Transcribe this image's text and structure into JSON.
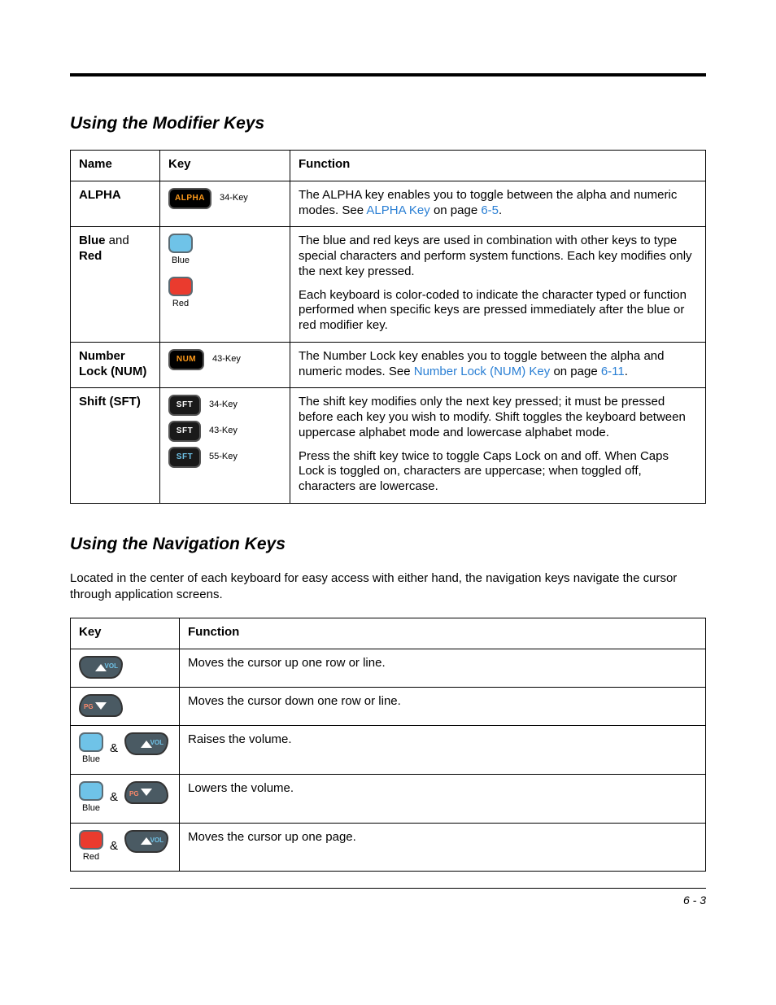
{
  "section1": {
    "title": "Using the Modifier Keys",
    "headers": {
      "name": "Name",
      "key": "Key",
      "function": "Function"
    },
    "rows": {
      "alpha": {
        "name": "ALPHA",
        "keycap": "ALPHA",
        "keycap_note": "34-Key",
        "func_pre": "The ALPHA key enables you to toggle between the alpha and numeric modes. See ",
        "func_link": "ALPHA Key",
        "func_mid": " on page ",
        "func_page": "6-5",
        "func_post": "."
      },
      "bluered": {
        "name_a": "Blue",
        "name_b": " and ",
        "name_c": "Red",
        "blue_label": "Blue",
        "red_label": "Red",
        "p1": "The blue and red keys are used in combination with other keys to type special characters and perform system functions. Each key modifies only the next key pressed.",
        "p2": "Each keyboard is color-coded to indicate the character typed or function performed when specific keys are pressed immediately after the blue or red modifier key."
      },
      "num": {
        "name": "Number Lock (NUM)",
        "keycap": "NUM",
        "keycap_note": "43-Key",
        "func_pre": "The Number Lock key enables you to toggle between the alpha and numeric modes. See ",
        "func_link": "Number Lock (NUM) Key",
        "func_mid": " on page ",
        "func_page": "6-11",
        "func_post": "."
      },
      "shift": {
        "name": "Shift (SFT)",
        "keycap": "SFT",
        "note34": "34-Key",
        "note43": "43-Key",
        "note55": "55-Key",
        "p1": "The shift key modifies only the next key pressed; it must be pressed before each key you wish to modify. Shift toggles the keyboard between uppercase alphabet mode and lowercase alphabet mode.",
        "p2": "Press the shift key twice to toggle Caps Lock on and off. When Caps Lock is toggled on, characters are uppercase; when toggled off, characters are lowercase."
      }
    }
  },
  "section2": {
    "title": "Using the Navigation Keys",
    "intro": "Located in the center of each keyboard for easy access with either hand, the navigation keys navigate the cursor through application screens.",
    "headers": {
      "key": "Key",
      "function": "Function"
    },
    "labels": {
      "vol": "VOL",
      "pg": "PG",
      "blue": "Blue",
      "red": "Red",
      "amp": "&"
    },
    "rows": {
      "up": {
        "func": "Moves the cursor up one row or line."
      },
      "down": {
        "func": "Moves the cursor down one row or line."
      },
      "volup": {
        "func": "Raises the volume."
      },
      "voldn": {
        "func": "Lowers the volume."
      },
      "pgup": {
        "func": "Moves the cursor up one page."
      }
    }
  },
  "footer": {
    "page": "6 - 3"
  }
}
